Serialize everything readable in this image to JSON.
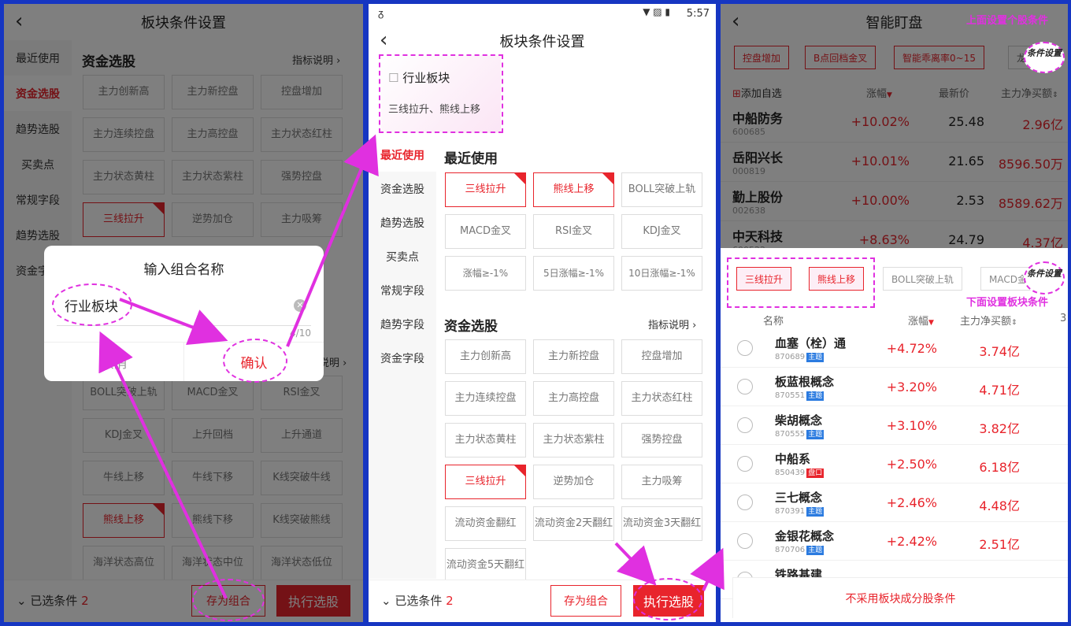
{
  "colors": {
    "accent": "#e8242c",
    "annotation": "#e030e0",
    "background": "#1636c2"
  },
  "p1": {
    "title": "板块条件设置",
    "sidebar": [
      "最近使用",
      "资金选股",
      "趋势选股",
      "买卖点",
      "常规字段",
      "趋势选股",
      "资金字段"
    ],
    "section_title": "资金选股",
    "help": "指标说明",
    "grid": [
      "主力创新高",
      "主力新控盘",
      "控盘增加",
      "主力连续控盘",
      "主力高控盘",
      "主力状态红柱",
      "主力状态黄柱",
      "主力状态紫柱",
      "强势控盘",
      "三线拉升",
      "逆势加仓",
      "主力吸筹"
    ],
    "help2": "说明",
    "grid2": [
      "BOLL突破上轨",
      "MACD金叉",
      "RSI金叉",
      "KDJ金叉",
      "上升回档",
      "上升通道",
      "牛线上移",
      "牛线下移",
      "K线突破牛线",
      "熊线上移",
      "熊线下移",
      "K线突破熊线",
      "海洋状态高位",
      "海洋状态中位",
      "海洋状态低位"
    ],
    "selected_label": "已选条件",
    "selected_count": "2",
    "save": "存为组合",
    "run": "执行选股",
    "dialog": {
      "title": "输入组合名称",
      "value": "行业板块",
      "counter": "4/10",
      "cancel": "取消",
      "confirm": "确认"
    }
  },
  "p2": {
    "time": "5:57",
    "title": "板块条件设置",
    "preset_title": "行业板块",
    "preset_desc": "三线拉升、熊线上移",
    "sidebar": [
      "最近使用",
      "资金选股",
      "趋势选股",
      "买卖点",
      "常规字段",
      "趋势字段",
      "资金字段"
    ],
    "recent_title": "最近使用",
    "recent": [
      "三线拉升",
      "熊线上移",
      "BOLL突破上轨",
      "MACD金叉",
      "RSI金叉",
      "KDJ金叉",
      "涨幅≥-1%",
      "5日涨幅≥-1%",
      "10日涨幅≥-1%"
    ],
    "fund_title": "资金选股",
    "help": "指标说明",
    "fund": [
      "主力创新高",
      "主力新控盘",
      "控盘增加",
      "主力连续控盘",
      "主力高控盘",
      "主力状态红柱",
      "主力状态黄柱",
      "主力状态紫柱",
      "强势控盘",
      "三线拉升",
      "逆势加仓",
      "主力吸筹",
      "流动资金翻红",
      "流动资金2天翻红",
      "流动资金3天翻红",
      "流动资金5天翻红"
    ],
    "selected_label": "已选条件",
    "selected_count": "2",
    "save": "存为组合",
    "run": "执行选股"
  },
  "p3": {
    "title": "智能盯盘",
    "anno_top": "上面设置个股条件",
    "anno_bottom": "下面设置板块条件",
    "cond_label": "条件设置",
    "chips": [
      "控盘增加",
      "B点回档金叉",
      "智能乖离率0~15",
      "龙出"
    ],
    "cols": {
      "add": "添加自选",
      "change": "涨幅",
      "price": "最新价",
      "net": "主力净买额"
    },
    "stocks": [
      {
        "name": "中船防务",
        "code": "600685",
        "change": "+10.02%",
        "price": "25.48",
        "net": "2.96亿"
      },
      {
        "name": "岳阳兴长",
        "code": "000819",
        "change": "+10.01%",
        "price": "21.65",
        "net": "8596.50万"
      },
      {
        "name": "勤上股份",
        "code": "002638",
        "change": "+10.00%",
        "price": "2.53",
        "net": "8589.62万"
      },
      {
        "name": "中天科技",
        "code": "600522",
        "change": "+8.63%",
        "price": "24.79",
        "net": "4.37亿"
      }
    ],
    "sector_chips": [
      "三线拉升",
      "熊线上移",
      "BOLL突破上轨",
      "MACD金"
    ],
    "sector_cols": {
      "name": "名称",
      "change": "涨幅",
      "net": "主力净买额",
      "extra": "3"
    },
    "sectors": [
      {
        "name": "血塞（栓）通",
        "code": "870689",
        "tag": "主题",
        "change": "+4.72%",
        "net": "3.74亿"
      },
      {
        "name": "板蓝根概念",
        "code": "870551",
        "tag": "主题",
        "change": "+3.20%",
        "net": "4.71亿"
      },
      {
        "name": "柴胡概念",
        "code": "870555",
        "tag": "主题",
        "change": "+3.10%",
        "net": "3.82亿"
      },
      {
        "name": "中船系",
        "code": "850439",
        "tag": "盘口",
        "change": "+2.50%",
        "net": "6.18亿"
      },
      {
        "name": "三七概念",
        "code": "870391",
        "tag": "主题",
        "change": "+2.46%",
        "net": "4.48亿"
      },
      {
        "name": "金银花概念",
        "code": "870706",
        "tag": "主题",
        "change": "+2.42%",
        "net": "2.51亿"
      },
      {
        "name": "铁路基建",
        "code": "",
        "tag": "",
        "change": "",
        "net": ""
      }
    ],
    "footer": "不采用板块成分股条件"
  }
}
